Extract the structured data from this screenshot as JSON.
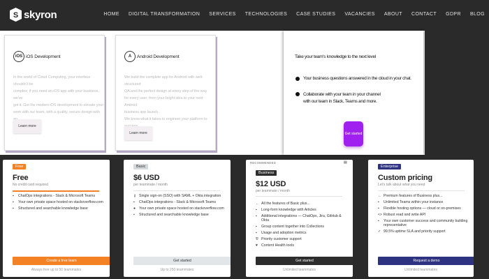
{
  "header": {
    "logo_text": "skyron",
    "nav": [
      "HOME",
      "DIGITAL TRANSFORMATION",
      "SERVICES",
      "TECHNOLOGIES",
      "CASE STUDIES",
      "VACANCIES",
      "ABOUT",
      "CONTACT",
      "GDPR",
      "BLOG"
    ]
  },
  "hero": {
    "cards": [
      {
        "icon": "ios-icon",
        "icon_text": "iOS",
        "title": "iOS Development",
        "body": [
          "In the world of Cloud Computing, your interface shouldn't be",
          "complex; if you need an iOS app with your business, we've",
          "got it. Get the modern iOS development to elevate your",
          "work with our team, with a quality, secure design with an",
          "app."
        ],
        "button": "Learn more"
      },
      {
        "icon": "android-icon",
        "icon_text": "A",
        "title": "Android Development",
        "body": [
          "We build the complete app for Android with well-structured",
          "QA and the perfect design at every step of the way",
          "for every user; from your bright idea to your next Android",
          "business app launch.",
          "We know what it takes to engineer your platform to success",
          "on Android."
        ],
        "button": "Learn more"
      }
    ],
    "mock": {
      "heading": "Take your team's knowledge to the next level",
      "points": [
        "Your business questions answered in the cloud in your chat.",
        "Collaborate with your team in your channel with our team in Slack, Teams and more."
      ],
      "button": "Get started"
    }
  },
  "pricing": [
    {
      "badge": "Free",
      "price": "Free",
      "price_sub": "No credit card required",
      "features": [
        {
          "icon": "chat-icon",
          "text": "ChatOps integrations - Slack & Microsoft Teams"
        },
        {
          "icon": "box-icon",
          "text": "Your own private space hosted on stackoverflow.com"
        },
        {
          "icon": "book-icon",
          "text": "Structured and searchable knowledge base"
        }
      ],
      "cta": "Create a free team",
      "footnote": "Always free up to 50 teammates"
    },
    {
      "badge": "Basic",
      "price": "$6 USD",
      "price_sub": "per teammate / month",
      "features": [
        {
          "icon": "key-icon",
          "text": "Single sign-on (SSO) with SAML + Okta integration"
        },
        {
          "icon": "chat-icon",
          "text": "ChatOps integrations - Slack & Microsoft Teams"
        },
        {
          "icon": "globe-icon",
          "text": "Your own private space hosted on stackoverflow.com"
        },
        {
          "icon": "book-icon",
          "text": "Structured and searchable knowledge base"
        }
      ],
      "cta": "Get started",
      "footnote": "Up to 250 teammates"
    },
    {
      "recommended": "RECOMMENDED",
      "badge": "Business",
      "price": "$12 USD",
      "price_sub": "per teammate / month",
      "features": [
        {
          "icon": "arrow-icon",
          "text": "All the features of Basic plus..."
        },
        {
          "icon": "book-icon",
          "text": "Long-form knowledge with Articles"
        },
        {
          "icon": "plug-icon",
          "text": "Additional integrations — ChatOps, Jira, GitHub & Okta"
        },
        {
          "icon": "folder-icon",
          "text": "Group content together into Collections"
        },
        {
          "icon": "chart-icon",
          "text": "Usage and adoption metrics"
        },
        {
          "icon": "shield-icon",
          "text": "Priority customer support"
        },
        {
          "icon": "heart-icon",
          "text": "Content Health tools"
        }
      ],
      "cta": "Get started",
      "footnote": "Unlimited teammates"
    },
    {
      "badge": "Enterprise",
      "price": "Custom pricing",
      "price_sub": "Let's talk about what you need",
      "features": [
        {
          "icon": "arrow-icon",
          "text": "Premium features of Business plus..."
        },
        {
          "icon": "people-icon",
          "text": "Unlimited Teams within your instance"
        },
        {
          "icon": "cloud-icon",
          "text": "Flexible hosting options — cloud or on-premises"
        },
        {
          "icon": "api-icon",
          "text": "Robust read and write API"
        },
        {
          "icon": "person-icon",
          "text": "Your own customer success and community building representative"
        },
        {
          "icon": "check-icon",
          "text": "99.5% uptime SLA and priority support"
        }
      ],
      "cta": "Request a demo",
      "footnote": "Unlimited teammates"
    }
  ],
  "colors": {
    "free_accent": "#f48225",
    "basic_accent": "#d6d9dc",
    "business_accent": "#2d2d2d",
    "enterprise_accent": "#2d3380",
    "purple_button": "#a020f0"
  }
}
